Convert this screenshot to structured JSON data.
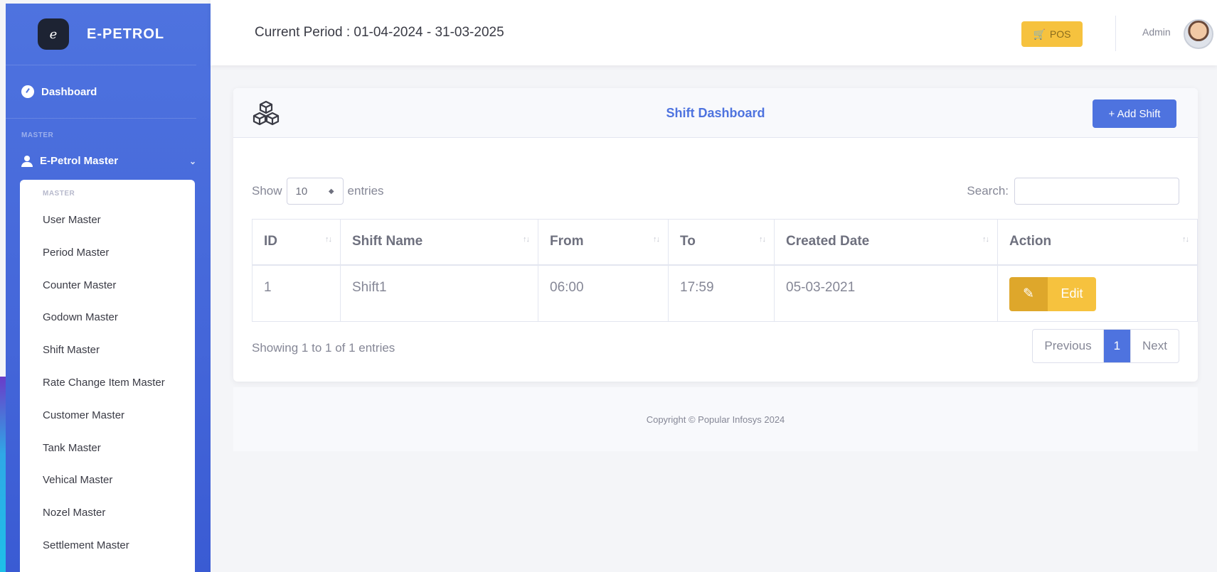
{
  "brand": {
    "name": "E-PETROL",
    "logo_text": "e"
  },
  "sidebar": {
    "dashboard_label": "Dashboard",
    "section_heading": "MASTER",
    "master_group_label": "E-Petrol Master",
    "submenu_heading": "MASTER",
    "submenu_items": [
      "User Master",
      "Period Master",
      "Counter Master",
      "Godown Master",
      "Shift Master",
      "Rate Change Item Master",
      "Customer Master",
      "Tank Master",
      "Vehical Master",
      "Nozel Master",
      "Settlement Master"
    ]
  },
  "topbar": {
    "period_text": "Current Period : 01-04-2024 - 31-03-2025",
    "pos_label": "POS",
    "user_name": "Admin"
  },
  "card": {
    "title": "Shift Dashboard",
    "add_button_label": "+ Add Shift"
  },
  "table_controls": {
    "show_label": "Show",
    "length_value": "10",
    "entries_label": "entries",
    "search_label": "Search:",
    "search_value": ""
  },
  "table": {
    "columns": [
      "ID",
      "Shift Name",
      "From",
      "To",
      "Created Date",
      "Action"
    ],
    "rows": [
      {
        "id": "1",
        "shift_name": "Shift1",
        "from": "06:00",
        "to": "17:59",
        "created_date": "05-03-2021",
        "action_label": "Edit"
      }
    ]
  },
  "pagination": {
    "info": "Showing 1 to 1 of 1 entries",
    "previous_label": "Previous",
    "current_page": "1",
    "next_label": "Next"
  },
  "footer": {
    "copyright": "Copyright © Popular Infosys 2024"
  },
  "colors": {
    "primary": "#4e73df",
    "warning": "#f6c23e",
    "warning_dark": "#dea72b"
  }
}
